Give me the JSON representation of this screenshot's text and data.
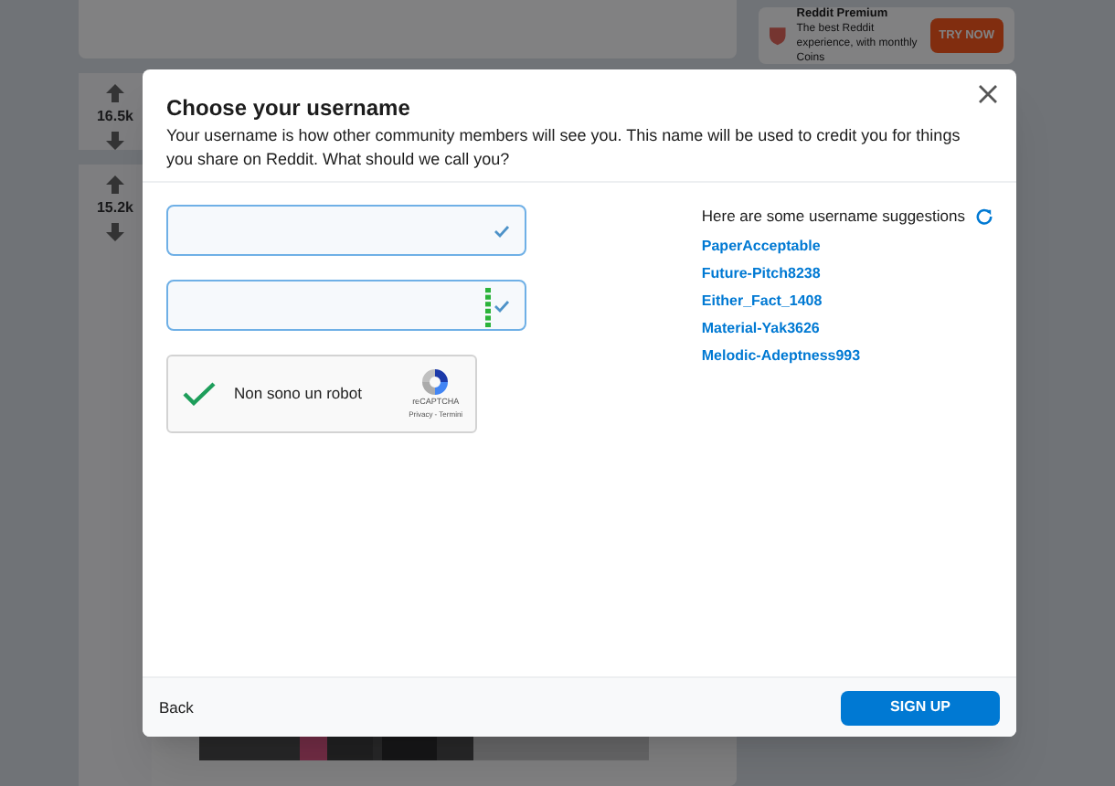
{
  "posts": [
    {
      "votes": "16.5k"
    },
    {
      "votes": "15.2k"
    }
  ],
  "premium": {
    "title": "Reddit Premium",
    "text": "The best Reddit experience, with monthly Coins",
    "button": "TRY NOW"
  },
  "dialog": {
    "title": "Choose your username",
    "description": "Your username is how other community members will see you. This name will be used to credit you for things you share on Reddit. What should we call you?",
    "fields": [
      {
        "kind": "username",
        "valid": true
      },
      {
        "kind": "password",
        "valid": true
      }
    ],
    "captcha": {
      "checked": true,
      "label": "Non sono un robot",
      "brand": "reCAPTCHA",
      "links": "Privacy - Termini"
    },
    "suggestions_heading": "Here are some username suggestions",
    "suggestions": [
      "PaperAcceptable",
      "Future-Pitch8238",
      "Either_Fact_1408",
      "Material-Yak3626",
      "Melodic-Adeptness993"
    ],
    "back": "Back",
    "submit": "SIGN UP"
  }
}
